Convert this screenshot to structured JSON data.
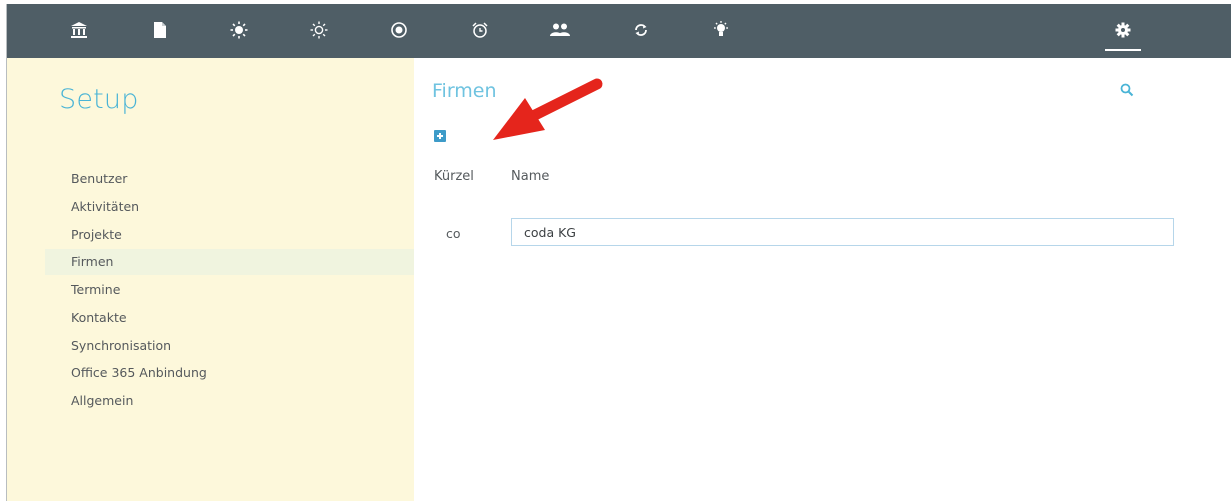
{
  "topbar": {
    "icons": [
      "bank-icon",
      "document-icon",
      "sun-icon",
      "sun-outline-icon",
      "target-icon",
      "alarm-clock-icon",
      "users-icon",
      "refresh-icon",
      "lightbulb-icon",
      "gear-icon"
    ],
    "active": "gear-icon",
    "background": "#4f5e66"
  },
  "sidebar": {
    "title": "Setup",
    "items": [
      {
        "label": "Benutzer"
      },
      {
        "label": "Aktivitäten"
      },
      {
        "label": "Projekte"
      },
      {
        "label": "Firmen",
        "active": true
      },
      {
        "label": "Termine"
      },
      {
        "label": "Kontakte"
      },
      {
        "label": "Synchronisation"
      },
      {
        "label": "Office 365 Anbindung"
      },
      {
        "label": "Allgemein"
      }
    ],
    "background": "#fdf8db"
  },
  "main": {
    "title": "Firmen",
    "columns": {
      "code": "Kürzel",
      "name": "Name"
    },
    "rows": [
      {
        "code": "co",
        "name": "coda KG"
      }
    ]
  },
  "accent": "#4ab4d6",
  "annotation_arrow_color": "#e5251c"
}
